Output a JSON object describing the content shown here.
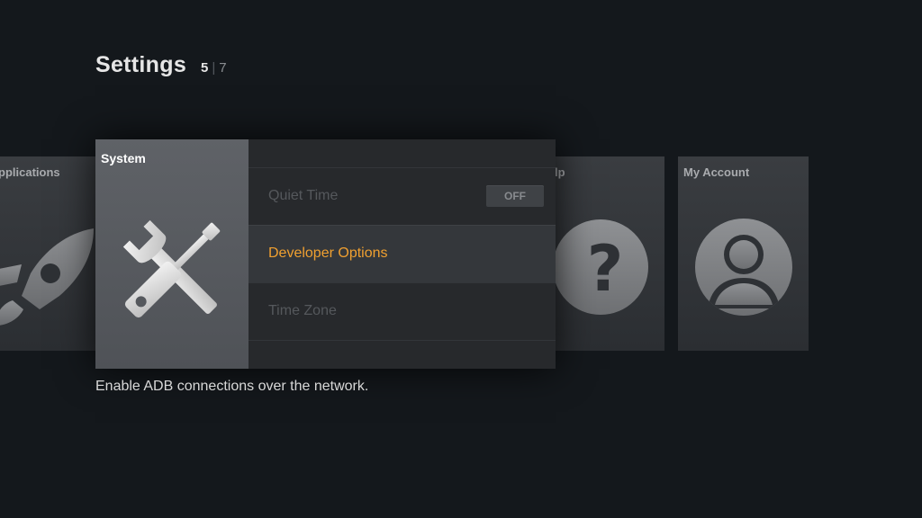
{
  "header": {
    "title": "Settings",
    "page_current": "5",
    "page_separator": "|",
    "page_total": "7"
  },
  "categories": {
    "applications": {
      "label": "pplications",
      "icon": "rocket-icon"
    },
    "system": {
      "label": "System",
      "icon": "tools-icon"
    },
    "help": {
      "label": "lp",
      "icon": "question-icon"
    },
    "my_account": {
      "label": "My Account",
      "icon": "user-icon"
    }
  },
  "system_menu": {
    "items": [
      {
        "label": "Quiet Time",
        "toggle": "OFF"
      },
      {
        "label": "Developer Options"
      },
      {
        "label": "Time Zone"
      }
    ],
    "selected_index": 1
  },
  "description": "Enable ADB connections over the network.",
  "colors": {
    "background": "#14181c",
    "accent": "#f0a030",
    "selected_card": "#5a5d62"
  }
}
